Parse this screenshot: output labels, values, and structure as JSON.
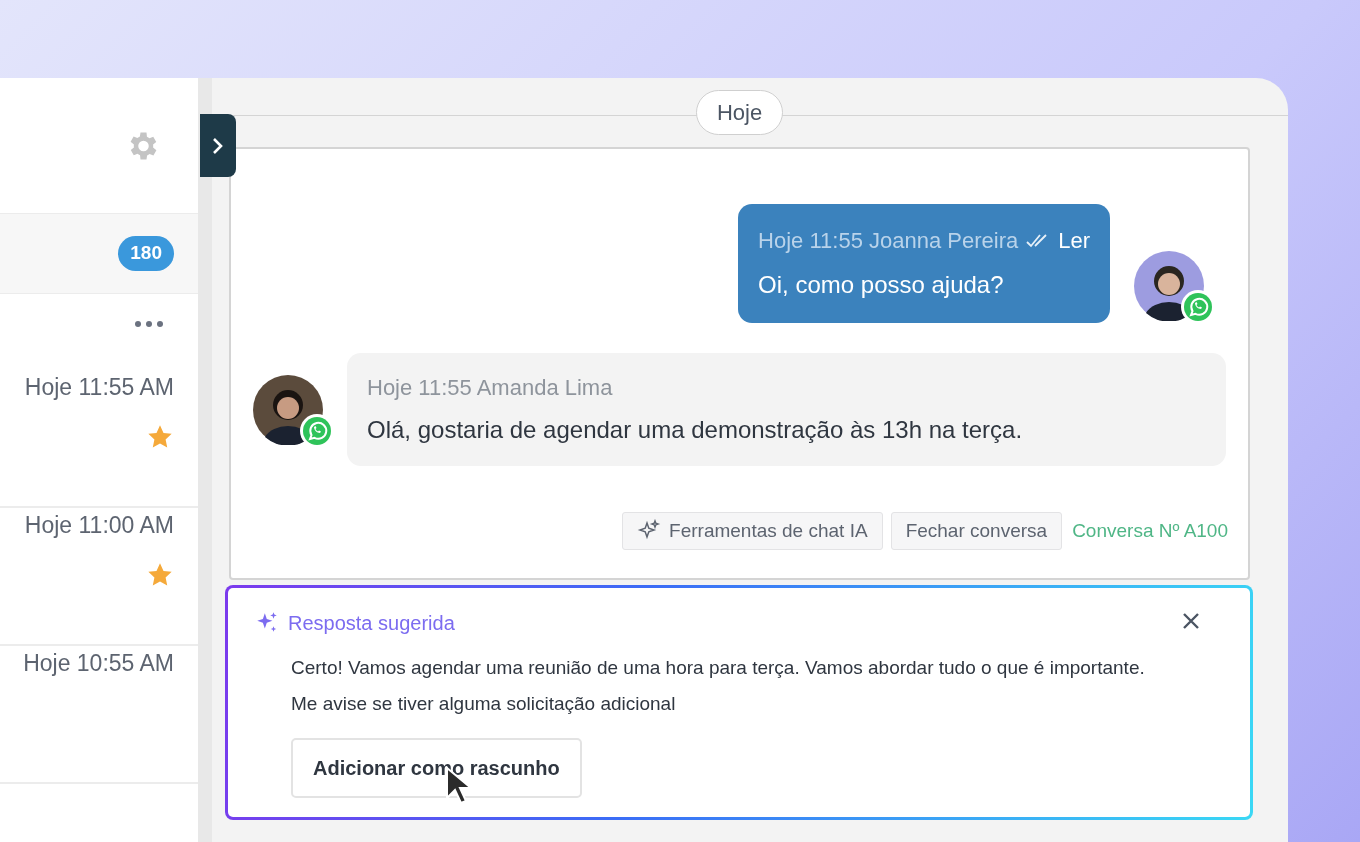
{
  "sidebar": {
    "badge": "180",
    "items": [
      {
        "time": "Hoje 11:55 AM",
        "starred": true
      },
      {
        "time": "Hoje 11:00 AM",
        "starred": true
      },
      {
        "time": "Hoje 10:55 AM",
        "starred": false
      }
    ]
  },
  "chat": {
    "date": "Hoje",
    "messages": [
      {
        "kind": "outgoing",
        "meta": "Hoje 11:55 Joanna Pereira",
        "status": "Ler",
        "text": "Oi, como posso ajuda?"
      },
      {
        "kind": "incoming",
        "meta": "Hoje 11:55 Amanda Lima",
        "text": "Olá, gostaria de agendar uma demonstração às 13h na terça."
      }
    ],
    "actions": [
      {
        "kind": "ai",
        "label": "Ferramentas de chat IA"
      },
      {
        "kind": "plain",
        "label": "Fechar conversa"
      }
    ],
    "conversation_id": "Conversa Nº A100"
  },
  "suggestion": {
    "title": "Resposta sugerida",
    "text": "Certo! Vamos agendar uma reunião de uma hora para terça. Vamos abordar tudo o que é importante. Me avise se tiver alguma solicitação adicional",
    "button": "Adicionar como rascunho"
  }
}
